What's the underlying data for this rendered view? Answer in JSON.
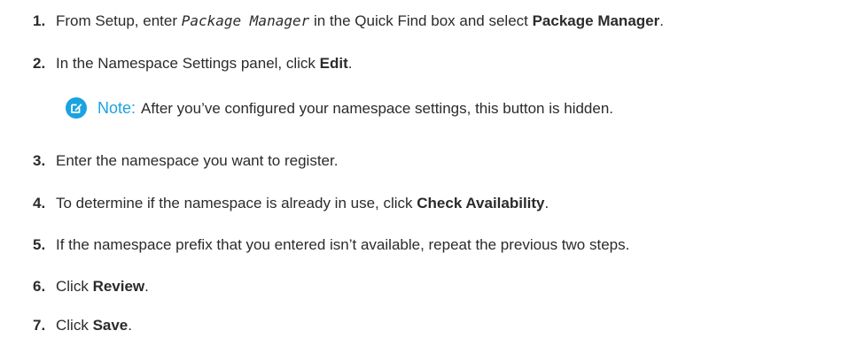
{
  "steps": [
    {
      "num": "1.",
      "pre": "From Setup, enter ",
      "code": "Package Manager",
      "mid": " in the Quick Find box and select ",
      "bold": "Package Manager",
      "post": "."
    },
    {
      "num": "2.",
      "pre": "In the Namespace Settings panel, click ",
      "bold": "Edit",
      "post": "."
    },
    {
      "num": "3.",
      "text": "Enter the namespace you want to register."
    },
    {
      "num": "4.",
      "pre": "To determine if the namespace is already in use, click ",
      "bold": "Check Availability",
      "post": "."
    },
    {
      "num": "5.",
      "text": "If the namespace prefix that you entered isn’t available, repeat the previous two steps."
    },
    {
      "num": "6.",
      "pre": "Click ",
      "bold": "Review",
      "post": "."
    },
    {
      "num": "7.",
      "pre": "Click ",
      "bold": "Save",
      "post": "."
    }
  ],
  "note": {
    "icon": "edit-note-icon",
    "label": "Note:",
    "text": "After you’ve configured your namespace settings, this button is hidden.",
    "accent_color": "#1aa3e0"
  }
}
